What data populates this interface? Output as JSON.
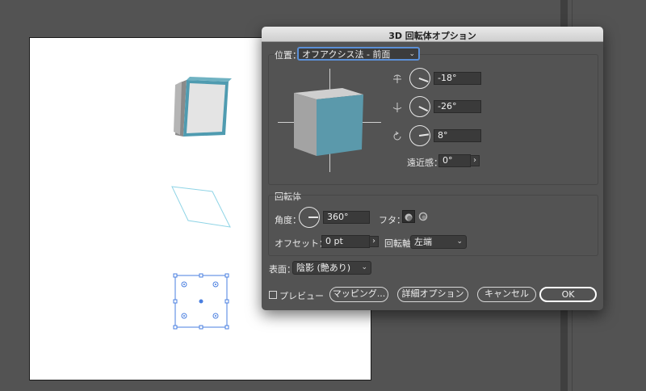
{
  "dialog": {
    "title": "3D 回転体オプション",
    "position_label": "位置：",
    "position_value": "オフアクシス法 - 前面",
    "rotation": {
      "x_value": "-18°",
      "y_value": "-26°",
      "z_value": "8°"
    },
    "perspective_label": "遠近感：",
    "perspective_value": "0°",
    "revolve_section": "回転体",
    "angle_label": "角度：",
    "angle_value": "360°",
    "cap_label": "フタ：",
    "offset_label": "オフセット：",
    "offset_value": "0 pt",
    "axis_label": "回転軸",
    "axis_value": "左端",
    "surface_label": "表面：",
    "surface_value": "陰影 (艶あり)",
    "preview_label": "プレビュー",
    "buttons": {
      "mapping": "マッピング...",
      "advanced": "詳細オプション",
      "cancel": "キャンセル",
      "ok": "OK"
    }
  },
  "colors": {
    "accent": "#5b99ab",
    "selection": "#4a7fe0",
    "workspace": "#535353"
  }
}
